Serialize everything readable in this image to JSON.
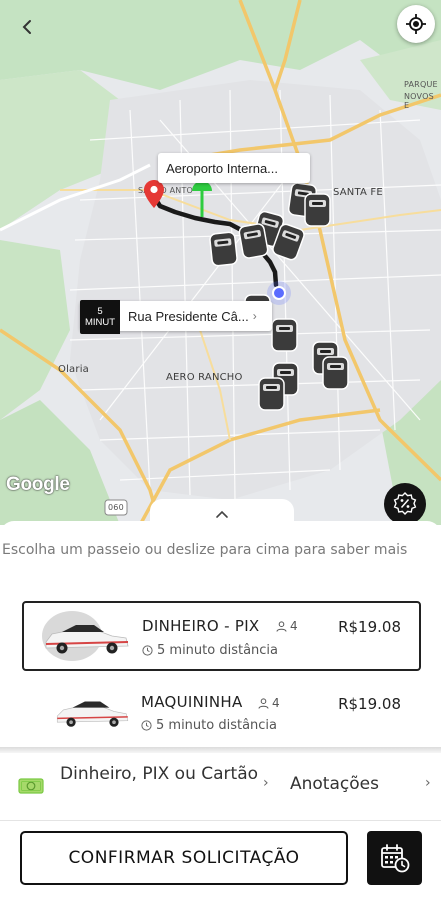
{
  "map": {
    "labels": {
      "santa_fe": "SANTA FE",
      "parque": "PARQUE",
      "novos": "NOVOS E",
      "olaria": "Olaria",
      "aero_rancho": "AERO RANCHO",
      "santo_anto": "SANTO ANTO",
      "shield": "060"
    },
    "google": "Google",
    "origin_callout": "Aeroporto Interna...",
    "dest_callout": "Rua Presidente Câ...",
    "eta_number": "5",
    "eta_unit": "MINUT",
    "icons": {
      "back": "back-arrow-icon",
      "locate": "my-location-icon",
      "promo": "discount-percent-icon"
    }
  },
  "sheet": {
    "hint": "Escolha um passeio ou deslize para cima para saber mais",
    "options": [
      {
        "name": "DINHEIRO - PIX",
        "seats": "4",
        "price": "R$19.08",
        "eta": "5 minuto distância"
      },
      {
        "name": "MAQUININHA",
        "seats": "4",
        "price": "R$19.08",
        "eta": "5 minuto distância"
      }
    ],
    "payment": "Dinheiro, PIX ou Cartão",
    "notes": "Anotações",
    "confirm": "CONFIRMAR SOLICITAÇÃO"
  },
  "colors": {
    "accent": "#111111",
    "route": "#1a1a1a",
    "pickup_pin": "#2ecc40",
    "dropoff_pin": "#e53935",
    "user_dot": "#5b6cff",
    "payment_icon": "#7ac943"
  }
}
